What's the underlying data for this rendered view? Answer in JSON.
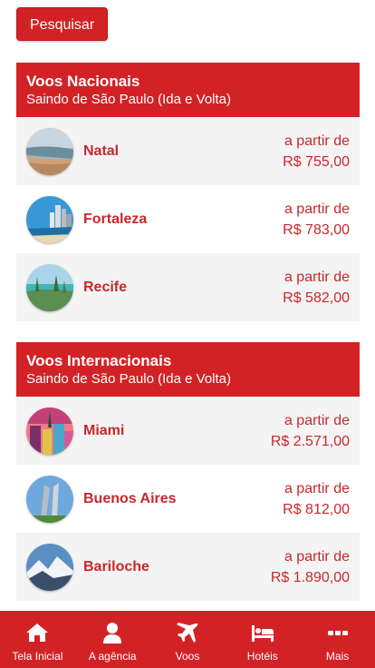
{
  "top": {
    "search_label": "Pesquisar"
  },
  "sections": [
    {
      "title": "Voos Nacionais",
      "subtitle": "Saindo de São Paulo (Ida e Volta)",
      "items": [
        {
          "city": "Natal",
          "from_label": "a partir de",
          "price": "R$ 755,00"
        },
        {
          "city": "Fortaleza",
          "from_label": "a partir de",
          "price": "R$ 783,00"
        },
        {
          "city": "Recife",
          "from_label": "a partir de",
          "price": "R$ 582,00"
        }
      ]
    },
    {
      "title": "Voos Internacionais",
      "subtitle": "Saindo de São Paulo (Ida e Volta)",
      "items": [
        {
          "city": "Miami",
          "from_label": "a partir de",
          "price": "R$ 2.571,00"
        },
        {
          "city": "Buenos Aires",
          "from_label": "a partir de",
          "price": "R$ 812,00"
        },
        {
          "city": "Bariloche",
          "from_label": "a partir de",
          "price": "R$ 1.890,00"
        }
      ]
    }
  ],
  "nav": [
    {
      "label": "Tela Inicial",
      "icon": "home-icon"
    },
    {
      "label": "A agência",
      "icon": "user-icon"
    },
    {
      "label": "Voos",
      "icon": "plane-icon"
    },
    {
      "label": "Hotéis",
      "icon": "bed-icon"
    },
    {
      "label": "Mais",
      "icon": "more-icon"
    }
  ],
  "colors": {
    "brand_red": "#d32226",
    "text_red": "#c8282c",
    "row_shade": "#f4f4f4"
  }
}
